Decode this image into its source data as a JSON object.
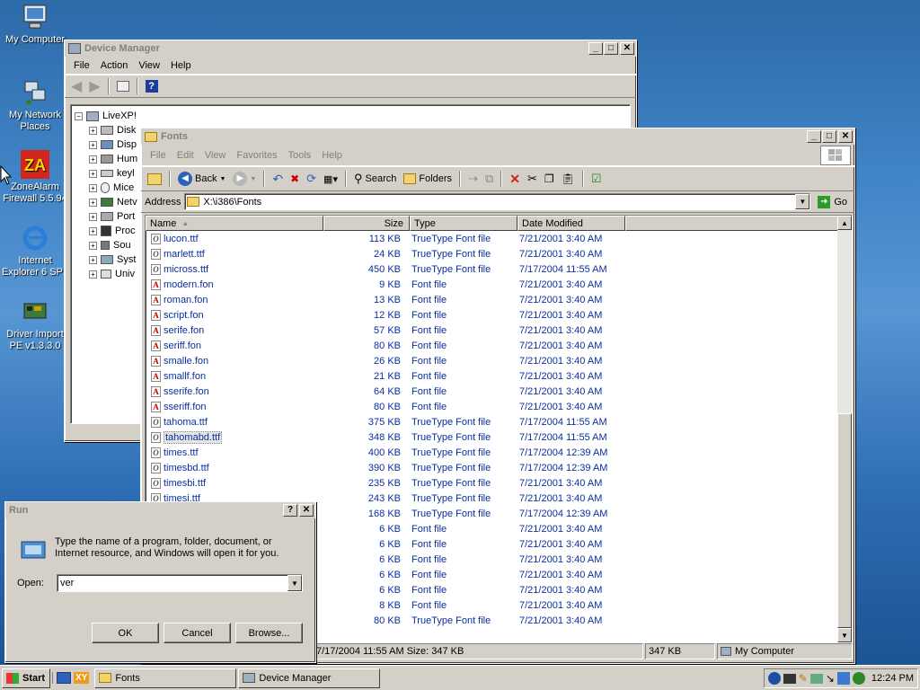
{
  "desktop": {
    "icons": [
      {
        "label": "My Computer"
      },
      {
        "label": "My Network Places"
      },
      {
        "label": "ZoneAlarm Firewall 5.5.94"
      },
      {
        "label": "Internet Explorer 6 SP1"
      },
      {
        "label": "Driver Import PE v1.3.3.0"
      }
    ]
  },
  "device_manager": {
    "title": "Device Manager",
    "menu": [
      "File",
      "Action",
      "View",
      "Help"
    ],
    "root": "LiveXP!",
    "tree": [
      "Disk",
      "Disp",
      "Hum",
      "keyl",
      "Mice",
      "Netv",
      "Port",
      "Proc",
      "Sou",
      "Syst",
      "Univ"
    ]
  },
  "fonts": {
    "title": "Fonts",
    "menu": [
      "File",
      "Edit",
      "View",
      "Favorites",
      "Tools",
      "Help"
    ],
    "toolbar": {
      "back": "Back",
      "search": "Search",
      "folders": "Folders"
    },
    "address_label": "Address",
    "address_value": "X:\\i386\\Fonts",
    "go_label": "Go",
    "columns": {
      "name": "Name",
      "size": "Size",
      "type": "Type",
      "date": "Date Modified"
    },
    "rows": [
      {
        "name": "lucon.ttf",
        "size": "113 KB",
        "type": "TrueType Font file",
        "date": "7/21/2001 3:40 AM",
        "kind": "tt"
      },
      {
        "name": "marlett.ttf",
        "size": "24 KB",
        "type": "TrueType Font file",
        "date": "7/21/2001 3:40 AM",
        "kind": "tt"
      },
      {
        "name": "micross.ttf",
        "size": "450 KB",
        "type": "TrueType Font file",
        "date": "7/17/2004 11:55 AM",
        "kind": "tt"
      },
      {
        "name": "modern.fon",
        "size": "9 KB",
        "type": "Font file",
        "date": "7/21/2001 3:40 AM",
        "kind": "fn"
      },
      {
        "name": "roman.fon",
        "size": "13 KB",
        "type": "Font file",
        "date": "7/21/2001 3:40 AM",
        "kind": "fn"
      },
      {
        "name": "script.fon",
        "size": "12 KB",
        "type": "Font file",
        "date": "7/21/2001 3:40 AM",
        "kind": "fn"
      },
      {
        "name": "serife.fon",
        "size": "57 KB",
        "type": "Font file",
        "date": "7/21/2001 3:40 AM",
        "kind": "fn"
      },
      {
        "name": "seriff.fon",
        "size": "80 KB",
        "type": "Font file",
        "date": "7/21/2001 3:40 AM",
        "kind": "fn"
      },
      {
        "name": "smalle.fon",
        "size": "26 KB",
        "type": "Font file",
        "date": "7/21/2001 3:40 AM",
        "kind": "fn"
      },
      {
        "name": "smallf.fon",
        "size": "21 KB",
        "type": "Font file",
        "date": "7/21/2001 3:40 AM",
        "kind": "fn"
      },
      {
        "name": "sserife.fon",
        "size": "64 KB",
        "type": "Font file",
        "date": "7/21/2001 3:40 AM",
        "kind": "fn"
      },
      {
        "name": "sseriff.fon",
        "size": "80 KB",
        "type": "Font file",
        "date": "7/21/2001 3:40 AM",
        "kind": "fn"
      },
      {
        "name": "tahoma.ttf",
        "size": "375 KB",
        "type": "TrueType Font file",
        "date": "7/17/2004 11:55 AM",
        "kind": "tt"
      },
      {
        "name": "tahomabd.ttf",
        "size": "348 KB",
        "type": "TrueType Font file",
        "date": "7/17/2004 11:55 AM",
        "kind": "tt",
        "selected": true
      },
      {
        "name": "times.ttf",
        "size": "400 KB",
        "type": "TrueType Font file",
        "date": "7/17/2004 12:39 AM",
        "kind": "tt"
      },
      {
        "name": "timesbd.ttf",
        "size": "390 KB",
        "type": "TrueType Font file",
        "date": "7/17/2004 12:39 AM",
        "kind": "tt"
      },
      {
        "name": "timesbi.ttf",
        "size": "235 KB",
        "type": "TrueType Font file",
        "date": "7/21/2001 3:40 AM",
        "kind": "tt"
      },
      {
        "name": "timesi.ttf",
        "size": "243 KB",
        "type": "TrueType Font file",
        "date": "7/21/2001 3:40 AM",
        "kind": "tt"
      },
      {
        "name": "",
        "size": "168 KB",
        "type": "TrueType Font file",
        "date": "7/17/2004 12:39 AM",
        "kind": "tt"
      },
      {
        "name": "",
        "size": "6 KB",
        "type": "Font file",
        "date": "7/21/2001 3:40 AM",
        "kind": "fn"
      },
      {
        "name": "",
        "size": "6 KB",
        "type": "Font file",
        "date": "7/21/2001 3:40 AM",
        "kind": "fn"
      },
      {
        "name": "",
        "size": "6 KB",
        "type": "Font file",
        "date": "7/21/2001 3:40 AM",
        "kind": "fn"
      },
      {
        "name": "",
        "size": "6 KB",
        "type": "Font file",
        "date": "7/21/2001 3:40 AM",
        "kind": "fn"
      },
      {
        "name": "",
        "size": "6 KB",
        "type": "Font file",
        "date": "7/21/2001 3:40 AM",
        "kind": "fn"
      },
      {
        "name": "",
        "size": "8 KB",
        "type": "Font file",
        "date": "7/21/2001 3:40 AM",
        "kind": "fn"
      },
      {
        "name": "",
        "size": "80 KB",
        "type": "TrueType Font file",
        "date": "7/21/2001 3:40 AM",
        "kind": "tt"
      }
    ],
    "status": {
      "info": "7/17/2004 11:55 AM Size: 347 KB",
      "size": "347 KB",
      "zone": "My Computer"
    }
  },
  "run_dialog": {
    "title": "Run",
    "help": "?",
    "description": "Type the name of a program, folder, document, or Internet resource, and Windows will open it for you.",
    "open_label": "Open:",
    "open_value": "ver",
    "ok": "OK",
    "cancel": "Cancel",
    "browse": "Browse..."
  },
  "taskbar": {
    "start": "Start",
    "tasks": [
      {
        "label": "Fonts"
      },
      {
        "label": "Device Manager"
      }
    ],
    "quick_launch_text": "XY",
    "clock": "12:24 PM"
  }
}
